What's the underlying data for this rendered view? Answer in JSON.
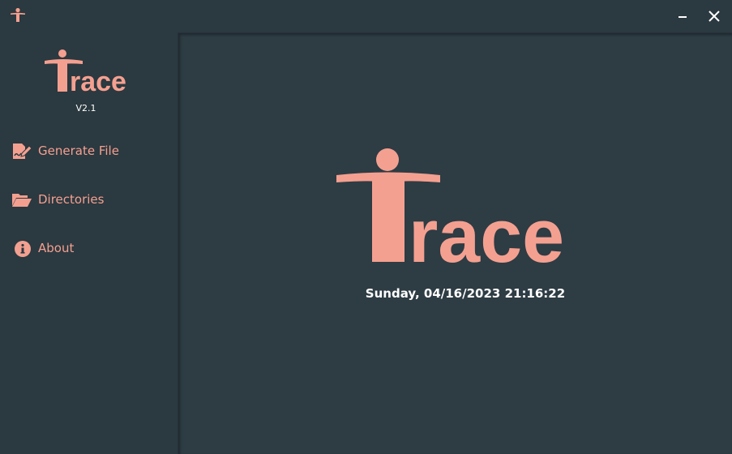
{
  "app": {
    "brand_name": "Trace",
    "version": "V2.1",
    "accent_color": "#f4a090",
    "background_color": "#2b3940",
    "panel_color": "#2e3c44"
  },
  "titlebar": {
    "app_icon": "trace-figure-icon",
    "minimize_icon": "minimize-icon",
    "close_icon": "close-icon"
  },
  "sidebar": {
    "items": [
      {
        "label": "Generate File",
        "icon": "file-signature-icon"
      },
      {
        "label": "Directories",
        "icon": "folder-open-icon"
      },
      {
        "label": "About",
        "icon": "info-circle-icon"
      }
    ]
  },
  "main": {
    "datetime": "Sunday, 04/16/2023 21:16:22"
  }
}
